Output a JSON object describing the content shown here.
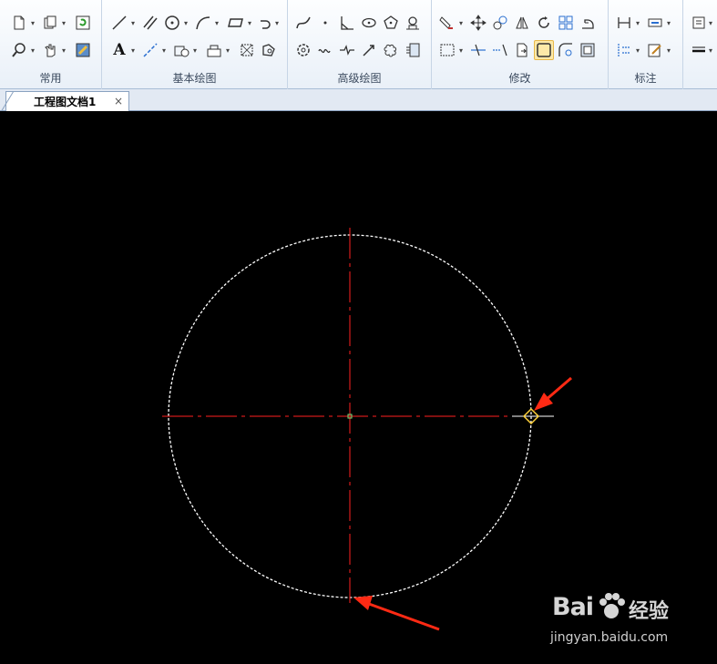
{
  "ribbon": {
    "groups": [
      {
        "title": "常用"
      },
      {
        "title": "基本绘图"
      },
      {
        "title": "高级绘图"
      },
      {
        "title": "修改"
      },
      {
        "title": "标注"
      }
    ],
    "text_tool_glyph": "A"
  },
  "tabs": {
    "document_title": "工程图文档1",
    "close_glyph": "×"
  },
  "watermark": {
    "brand_prefix": "Bai",
    "brand_suffix": "经验",
    "url": "jingyan.baidu.com"
  },
  "colors": {
    "circle": "#ffffff",
    "centerline": "#ff2020",
    "arrow": "#ff2a14",
    "grip": "#ffd23c",
    "background": "#000000"
  }
}
